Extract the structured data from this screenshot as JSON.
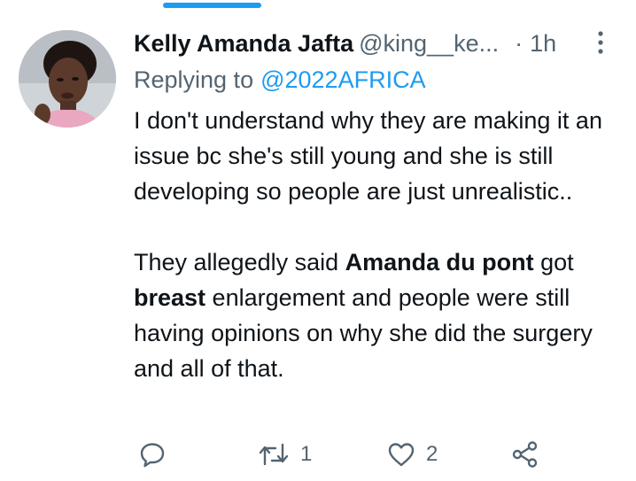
{
  "tweet": {
    "author": {
      "display_name": "Kelly Amanda Jafta",
      "handle": "@king__ke...",
      "avatar_icon": "user-avatar-photo"
    },
    "separator": "·",
    "time": "1h",
    "replying_to_label": "Replying to",
    "replying_to_handle": "@2022AFRICA",
    "body": {
      "paragraph_1": "I don't understand why they are making it an issue bc she's still young and she is still developing so people are just unrealistic..",
      "paragraph_2_part_1": "They allegedly said ",
      "paragraph_2_bold_1": "Amanda du pont",
      "paragraph_2_part_2": " got ",
      "paragraph_2_bold_2": "breast",
      "paragraph_2_part_3": " enlargement and people were still having opinions on why she did the surgery and all of that."
    },
    "actions": {
      "reply_icon": "comment-icon",
      "retweet_icon": "retweet-icon",
      "retweet_count": "1",
      "like_icon": "heart-icon",
      "like_count": "2",
      "share_icon": "share-icon"
    }
  },
  "colors": {
    "accent": "#1d9bf0",
    "text": "#0f1419",
    "secondary": "#536471",
    "background": "#ffffff"
  }
}
